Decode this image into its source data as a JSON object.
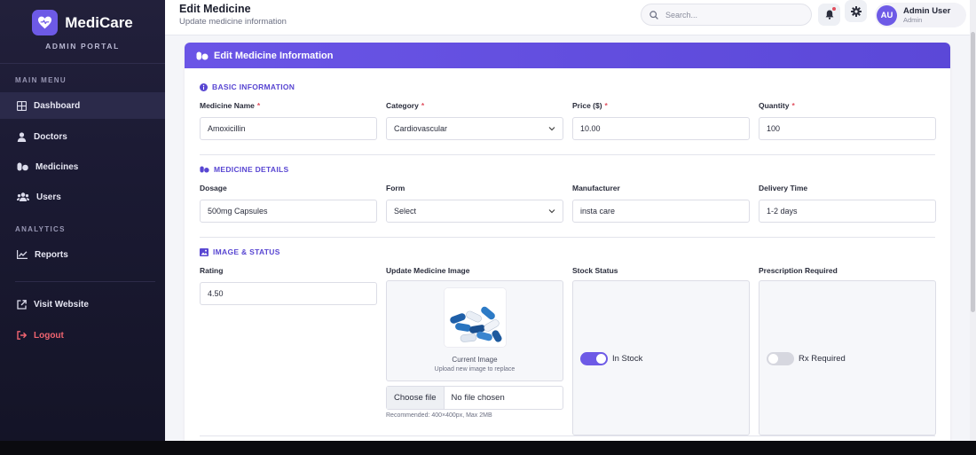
{
  "brand": {
    "name": "MediCare",
    "subtitle": "ADMIN PORTAL",
    "accent": "#6d5ae6"
  },
  "sidebar": {
    "main_menu_title": "MAIN MENU",
    "items": [
      {
        "label": "Dashboard",
        "icon": "grid-icon"
      },
      {
        "label": "Doctors",
        "icon": "user-md-icon"
      },
      {
        "label": "Medicines",
        "icon": "pills-icon"
      },
      {
        "label": "Users",
        "icon": "users-icon"
      }
    ],
    "analytics_title": "ANALYTICS",
    "reports_label": "Reports",
    "visit_label": "Visit Website",
    "logout_label": "Logout"
  },
  "header": {
    "title": "Edit Medicine",
    "subtitle": "Update medicine information",
    "search_placeholder": "Search..."
  },
  "user": {
    "initials": "AU",
    "name": "Admin User",
    "role": "Admin"
  },
  "card": {
    "title": "Edit Medicine Information"
  },
  "sections": {
    "basic": "BASIC INFORMATION",
    "details": "MEDICINE DETAILS",
    "image_status": "IMAGE & STATUS"
  },
  "form": {
    "name": {
      "label": "Medicine Name",
      "value": "Amoxicillin"
    },
    "category": {
      "label": "Category",
      "value": "Cardiovascular"
    },
    "price": {
      "label": "Price ($)",
      "value": "10.00"
    },
    "quantity": {
      "label": "Quantity",
      "value": "100"
    },
    "dosage": {
      "label": "Dosage",
      "value": "500mg Capsules"
    },
    "form_type": {
      "label": "Form",
      "value": "Select"
    },
    "manufacturer": {
      "label": "Manufacturer",
      "value": "insta care"
    },
    "delivery": {
      "label": "Delivery Time",
      "value": "1-2 days"
    },
    "rating": {
      "label": "Rating",
      "value": "4.50"
    },
    "image": {
      "label": "Update Medicine Image",
      "current": "Current Image",
      "hint": "Upload new image to replace",
      "choose_btn": "Choose file",
      "no_file": "No file chosen",
      "recommend": "Recommended: 400×400px, Max 2MB"
    },
    "stock": {
      "label": "Stock Status",
      "toggle_label": "In Stock",
      "on": true
    },
    "rx": {
      "label": "Prescription Required",
      "toggle_label": "Rx Required",
      "on": false
    }
  },
  "colors": {
    "required": "#e0505f",
    "toggle_on": "#6d5ae6",
    "toggle_off": "#d6d7df"
  }
}
